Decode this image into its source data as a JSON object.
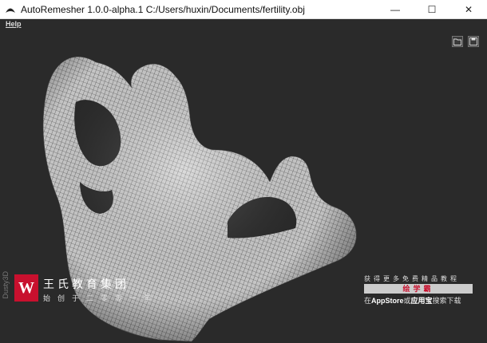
{
  "window": {
    "title": "AutoRemesher 1.0.0-alpha.1 C:/Users/huxin/Documents/fertility.obj",
    "minimize": "—",
    "maximize": "☐",
    "close": "✕"
  },
  "menu": {
    "help": "Help"
  },
  "toolbar": {
    "open_icon": "folder-open-icon",
    "save_icon": "save-icon"
  },
  "colors": {
    "background": "#2b2b2b",
    "mesh_fill": "#c9c9c9",
    "mesh_line": "#3c3c3c",
    "brand_red": "#c8102e"
  },
  "watermark": {
    "logo_letter": "W",
    "org_name": "王氏教育集团",
    "tagline": "始创于二零零一年",
    "side_text": "Dusty3D",
    "promo_top": "获得更多免费精品教程",
    "promo_bar": "绘学霸",
    "promo_bottom_prefix": "在",
    "promo_app1": "AppStore",
    "promo_mid": "或",
    "promo_app2": "应用宝",
    "promo_suffix": "搜索下载"
  }
}
